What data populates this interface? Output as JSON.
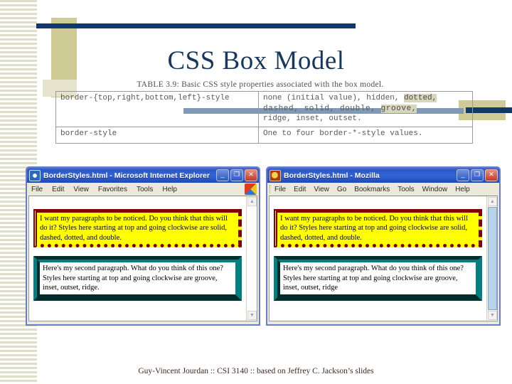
{
  "slide": {
    "title": "CSS Box Model",
    "footer": "Guy-Vincent Jourdan :: CSI 3140 :: based on Jeffrey C. Jackson’s slides",
    "accent_navy": "#10386b",
    "accent_khaki": "#cfcb94",
    "accent_steel": "#8099b4",
    "title_color": "#17375e"
  },
  "table_figure": {
    "caption": "TABLE 3.9: Basic CSS style properties associated with the box model.",
    "headers": [],
    "rows": [
      {
        "property": "border-{top,right,bottom,left}-style",
        "values_line1": "none (initial value), hidden, ",
        "values_line1_hl": "dotted,",
        "values_line2": "dashed,  solid,  double,  ",
        "values_line2_hl": "groove,",
        "values_line3": "ridge, inset, outset."
      },
      {
        "property": "border-style",
        "values_line1": "One to four border-*-style values.",
        "values_line1_hl": "",
        "values_line2": "",
        "values_line2_hl": "",
        "values_line3": ""
      }
    ]
  },
  "windows": [
    {
      "id": "ie",
      "title": "BorderStyles.html - Microsoft Internet Explorer",
      "app_icon": "internet-explorer-icon",
      "menus": [
        "File",
        "Edit",
        "View",
        "Favorites",
        "Tools",
        "Help"
      ],
      "buttons": {
        "minimize": "_",
        "maximize": "❐",
        "close": "✕"
      },
      "scrollbar": {
        "up": "▲",
        "down": "▼"
      },
      "paragraphs": [
        "I want my paragraphs to be noticed. Do you think that this will do it? Styles here starting at top and going clockwise are solid, dashed, dotted, and double.",
        "Here's my second paragraph. What do you think of this one? Styles here starting at top and going clockwise are groove, inset, outset, ridge."
      ]
    },
    {
      "id": "mozilla",
      "title": "BorderStyles.html - Mozilla",
      "app_icon": "mozilla-icon",
      "menus": [
        "File",
        "Edit",
        "View",
        "Go",
        "Bookmarks",
        "Tools",
        "Window",
        "Help"
      ],
      "buttons": {
        "minimize": "_",
        "maximize": "❐",
        "close": "✕"
      },
      "scrollbar": {
        "up": "▲",
        "down": "▼"
      },
      "paragraphs": [
        "I want my paragraphs to be noticed. Do you think that this will do it? Styles here starting at top and going clockwise are solid, dashed, dotted, and double.",
        "Here's my second paragraph. What do you think of this one? Styles here starting at top and going clockwise are groove, inset, outset, ridge"
      ]
    }
  ]
}
